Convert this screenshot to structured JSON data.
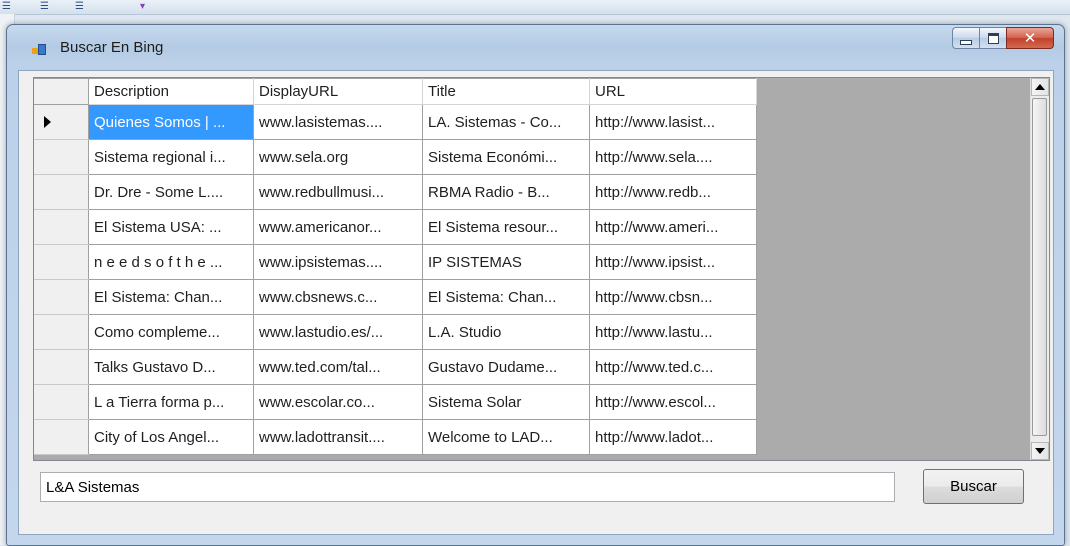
{
  "window": {
    "title": "Buscar En Bing"
  },
  "grid": {
    "columns": [
      "Description",
      "DisplayURL",
      "Title",
      "URL"
    ],
    "current_row_index": 0,
    "rows": [
      [
        "Quienes Somos | ...",
        "www.lasistemas....",
        "LA. Sistemas - Co...",
        "http://www.lasist..."
      ],
      [
        "Sistema regional i...",
        "www.sela.org",
        "Sistema Económi...",
        "http://www.sela...."
      ],
      [
        "Dr. Dre - Some L....",
        "www.redbullmusi...",
        "RBMA Radio - B...",
        "http://www.redb..."
      ],
      [
        "El Sistema USA: ...",
        "www.americanor...",
        "El Sistema resour...",
        "http://www.ameri..."
      ],
      [
        "n e e d s o f t h e ...",
        "www.ipsistemas....",
        "IP SISTEMAS",
        "http://www.ipsist..."
      ],
      [
        "El Sistema: Chan...",
        "www.cbsnews.c...",
        "El Sistema: Chan...",
        "http://www.cbsn..."
      ],
      [
        "Como compleme...",
        "www.lastudio.es/...",
        "L.A. Studio",
        "http://www.lastu..."
      ],
      [
        "Talks Gustavo D...",
        "www.ted.com/tal...",
        "Gustavo Dudame...",
        "http://www.ted.c..."
      ],
      [
        "L a Tierra forma p...",
        "www.escolar.co...",
        "Sistema Solar",
        "http://www.escol..."
      ],
      [
        "City of Los Angel...",
        "www.ladottransit....",
        "Welcome to LAD...",
        "http://www.ladot..."
      ]
    ]
  },
  "search": {
    "value": "L&A Sistemas",
    "button_label": "Buscar"
  },
  "icons": {
    "app": "form-window-icon",
    "minimize": "minimize-icon",
    "maximize": "maximize-icon",
    "close": "close-icon",
    "row_indicator": "current-row-arrow-icon",
    "scroll_up": "scroll-up-arrow-icon",
    "scroll_down": "scroll-down-arrow-icon"
  },
  "colors": {
    "selection": "#3399ff",
    "close_button": "#c1412d",
    "grid_background": "#ababab"
  }
}
